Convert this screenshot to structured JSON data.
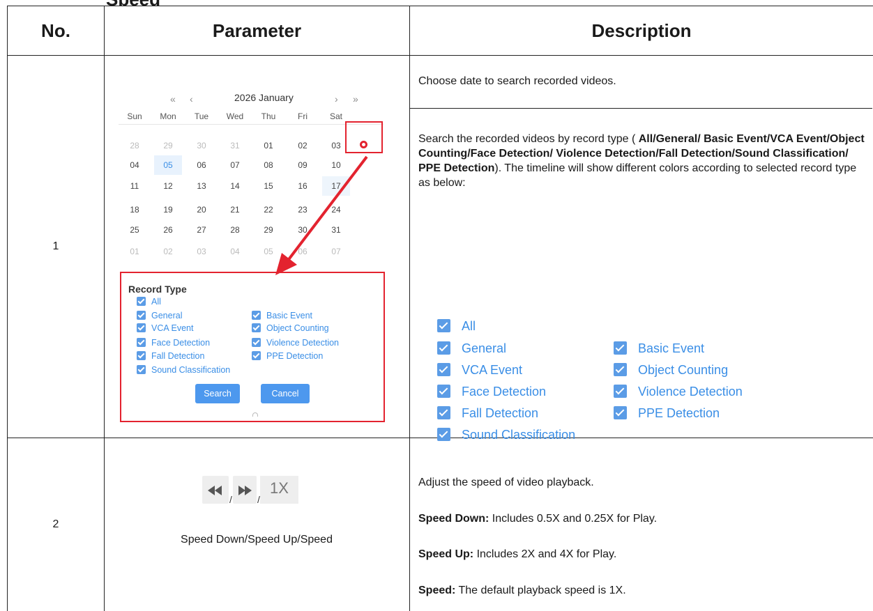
{
  "table": {
    "headers": {
      "no": "No.",
      "parameter": "Parameter",
      "description": "Description"
    },
    "rows": [
      {
        "no": "1",
        "calendar": {
          "nav_prev_year": "«",
          "nav_prev_month": "‹",
          "title": "2026 January",
          "nav_next_month": "›",
          "nav_next_year": "»",
          "weekdays": [
            "Sun",
            "Mon",
            "Tue",
            "Wed",
            "Thu",
            "Fri",
            "Sat"
          ],
          "weeks": [
            [
              "28",
              "29",
              "30",
              "31",
              "01",
              "02",
              "03"
            ],
            [
              "04",
              "05",
              "06",
              "07",
              "08",
              "09",
              "10"
            ],
            [
              "11",
              "12",
              "13",
              "14",
              "15",
              "16",
              "17"
            ],
            [
              "18",
              "19",
              "20",
              "21",
              "22",
              "23",
              "24"
            ],
            [
              "25",
              "26",
              "27",
              "28",
              "29",
              "30",
              "31"
            ],
            [
              "01",
              "02",
              "03",
              "04",
              "05",
              "06",
              "07"
            ]
          ],
          "selected_day": "05",
          "record_type_title": "Record Type",
          "options": {
            "all": "All",
            "general": "General",
            "basic_event": "Basic Event",
            "vca_event": "VCA Event",
            "object_counting": "Object Counting",
            "face_detection": "Face Detection",
            "violence_detection": "Violence Detection",
            "fall_detection": "Fall Detection",
            "ppe_detection": "PPE Detection",
            "sound_classification": "Sound Classification"
          },
          "search_button": "Search",
          "cancel_button": "Cancel"
        },
        "description_top": "Choose date to search recorded videos.",
        "description_body": {
          "intro": "Search the recorded videos by record type ( ",
          "types_bold": "All/General/ Basic Event/VCA Event/Object Counting/Face Detection/ Violence Detection/Fall Detection/Sound Classification/ PPE Detection",
          "outro": "). The timeline will show different colors according to selected record type as below:"
        },
        "legend": {
          "all": "All",
          "general": "General",
          "basic_event": "Basic Event",
          "vca_event": "VCA Event",
          "object_counting": "Object Counting",
          "face_detection": "Face Detection",
          "violence_detection": "Violence Detection",
          "fall_detection": "Fall Detection",
          "ppe_detection": "PPE Detection",
          "sound_classification": "Sound Classification"
        }
      },
      {
        "no": "2",
        "speed_separator": "/",
        "speed_value": "1X",
        "caption": "Speed Down/Speed Up/Speed",
        "desc_intro": "Adjust the speed of video playback.",
        "items": [
          {
            "label": "Speed Down:",
            "text": " Includes 0.5X and 0.25X for Play."
          },
          {
            "label": "Speed Up:",
            "text": " Includes 2X and 4X for Play."
          },
          {
            "label": "Speed:",
            "text": " The default playback speed is 1X."
          }
        ]
      }
    ]
  },
  "colors": {
    "accent_blue": "#3a8ee6",
    "highlight_red": "#e3232f",
    "button_blue": "#4d98ee"
  }
}
